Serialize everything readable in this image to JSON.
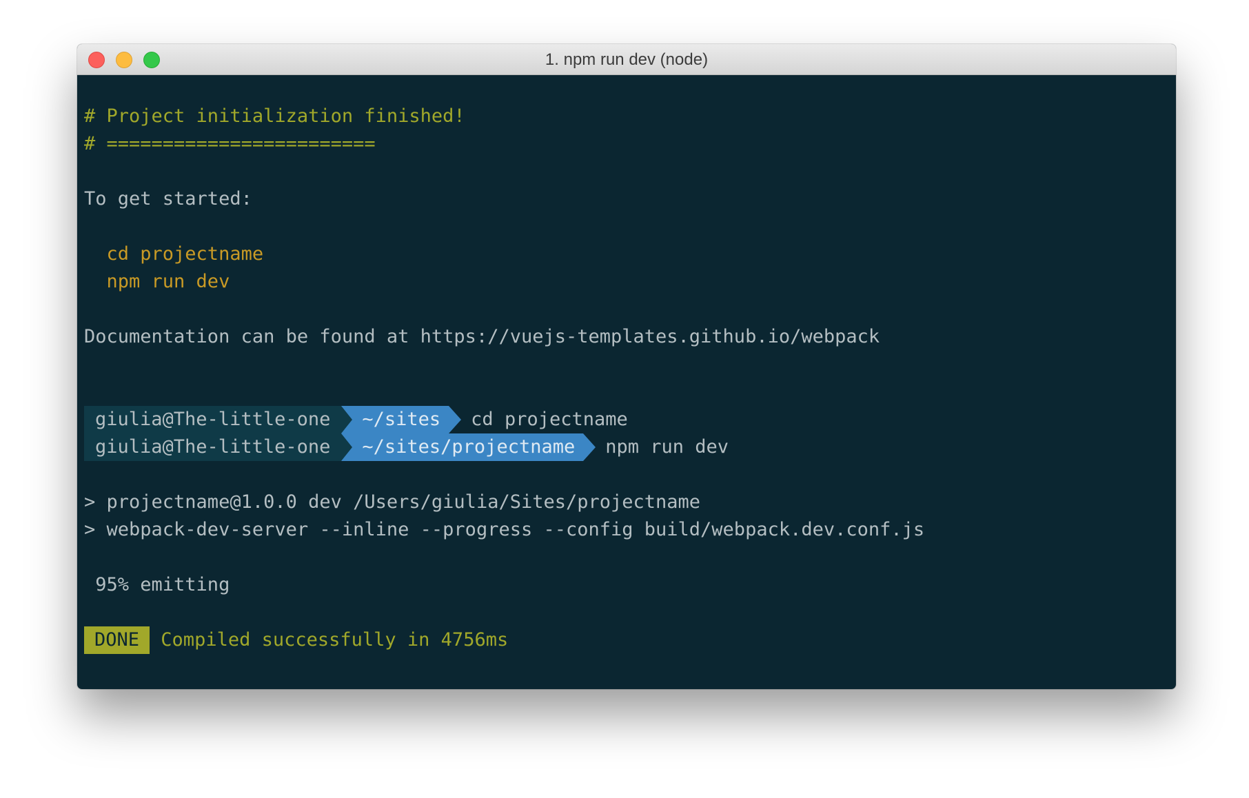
{
  "window": {
    "title": "1. npm run dev (node)"
  },
  "terminal": {
    "init_heading": "# Project initialization finished!",
    "init_rule": "# ========================",
    "get_started": "To get started:",
    "cmd_cd": "  cd projectname",
    "cmd_npm": "  npm run dev",
    "docs": "Documentation can be found at https://vuejs-templates.github.io/webpack",
    "prompts": [
      {
        "user": "giulia@The-little-one",
        "dir": "~/sites",
        "command": "cd projectname"
      },
      {
        "user": "giulia@The-little-one",
        "dir": "~/sites/projectname",
        "command": "npm run dev"
      }
    ],
    "script_line_1": "> projectname@1.0.0 dev /Users/giulia/Sites/projectname",
    "script_line_2": "> webpack-dev-server --inline --progress --config build/webpack.dev.conf.js",
    "progress": " 95% emitting",
    "done_badge": "DONE",
    "done_message": "Compiled successfully in 4756ms"
  },
  "colors": {
    "background": "#0b2631",
    "text": "#b4bec2",
    "yellow": "#a1a82a",
    "orange": "#c99a25",
    "prompt_user_bg": "#0f3a47",
    "prompt_dir_bg": "#3b86c5"
  }
}
